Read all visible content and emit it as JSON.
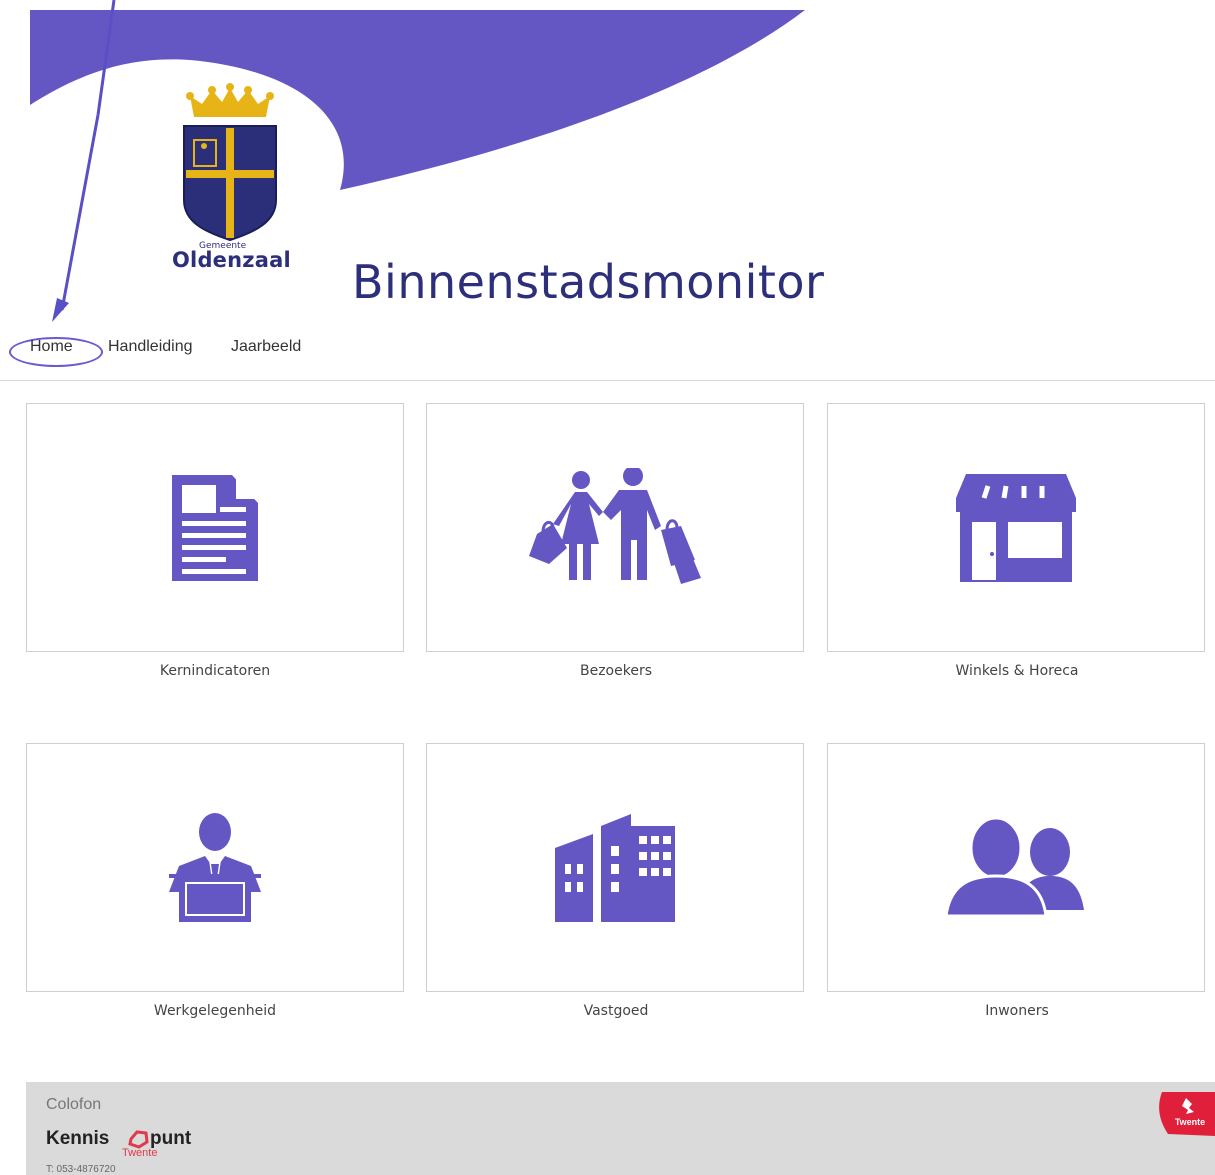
{
  "header": {
    "logo_gemeente": "Gemeente",
    "logo_name": "Oldenzaal",
    "site_title": "Binnenstadsmonitor"
  },
  "nav": {
    "items": [
      {
        "label": "Home"
      },
      {
        "label": "Handleiding"
      },
      {
        "label": "Jaarbeeld"
      }
    ]
  },
  "tiles": [
    {
      "label": "Kernindicatoren",
      "icon": "document-icon"
    },
    {
      "label": "Bezoekers",
      "icon": "shoppers-icon"
    },
    {
      "label": "Winkels & Horeca",
      "icon": "storefront-icon"
    },
    {
      "label": "Werkgelegenheid",
      "icon": "worker-at-desk-icon"
    },
    {
      "label": "Vastgoed",
      "icon": "buildings-icon"
    },
    {
      "label": "Inwoners",
      "icon": "residents-icon"
    }
  ],
  "footer": {
    "title": "Colofon",
    "org_name_part1": "Kennis",
    "org_name_part2": "punt",
    "org_name_sub": "Twente",
    "phone": "T: 053-4876720",
    "badge_text": "Twente"
  },
  "colors": {
    "accent": "#6a5acd",
    "icon": "#6457c4",
    "title": "#2d2f7a",
    "footer_bg": "#dadada",
    "badge": "#e0203a"
  }
}
